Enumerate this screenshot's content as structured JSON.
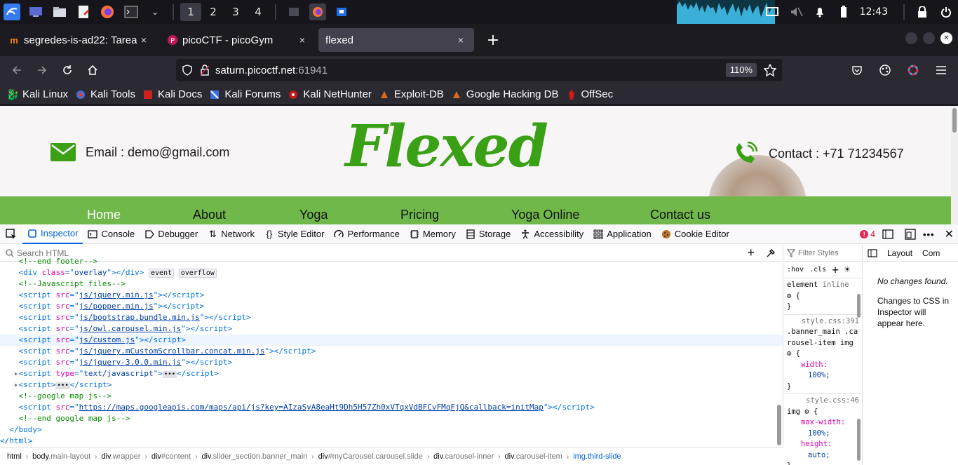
{
  "taskbar": {
    "workspaces": [
      "1",
      "2",
      "3",
      "4"
    ],
    "clock": "12:43"
  },
  "tabs": [
    {
      "title": "segredes-is-ad22: Tarea 5",
      "close": "×"
    },
    {
      "title": "picoCTF - picoGym",
      "close": "×"
    },
    {
      "title": "flexed",
      "close": "×"
    }
  ],
  "new_tab": "+",
  "urlbar": {
    "url_host": "saturn.picoctf.net",
    "url_port": ":61941",
    "zoom": "110%"
  },
  "bookmarks": [
    "Kali Linux",
    "Kali Tools",
    "Kali Docs",
    "Kali Forums",
    "Kali NetHunter",
    "Exploit-DB",
    "Google Hacking DB",
    "OffSec"
  ],
  "page": {
    "email": "Email : demo@gmail.com",
    "logo": "Flexed",
    "contact": "Contact : +71 71234567",
    "nav": [
      "Home",
      "About",
      "Yoga",
      "Pricing",
      "Yoga Online",
      "Contact us"
    ],
    "brand_color": "#3aa015",
    "nav_color": "#70b84a"
  },
  "devtools": {
    "tabs": [
      "Inspector",
      "Console",
      "Debugger",
      "Network",
      "Style Editor",
      "Performance",
      "Memory",
      "Storage",
      "Accessibility",
      "Application",
      "Cookie Editor"
    ],
    "error_count": "4",
    "search_placeholder": "Search HTML",
    "code_lines": {
      "l0": "<!--end footer-->",
      "l2": "<!--Javascript files-->",
      "l12": "<!--google map js-->",
      "l14": "<!--end google map js-->",
      "overlay_badges": [
        "event",
        "overflow"
      ],
      "scripts": [
        "js/jquery.min.js",
        "js/popper.min.js",
        "js/bootstrap.bundle.min.js",
        "js/owl.carousel.min.js",
        "js/custom.js",
        "js/jquery.mCustomScrollbar.concat.min.js",
        "js/jquery-3.0.0.min.js"
      ],
      "text_js_type": "text/javascript",
      "maps_src": "https://maps.googleapis.com/maps/api/js?key=AIzaSyA8eaHt9Dh5H57Zh0xVTqxVdBFCvFMqFjQ&callback=initMap"
    },
    "breadcrumbs": [
      {
        "tag": "html",
        "cls": ""
      },
      {
        "tag": "body",
        "cls": ".main-layout"
      },
      {
        "tag": "div",
        "cls": ".wrapper"
      },
      {
        "tag": "div",
        "cls": "#content"
      },
      {
        "tag": "div",
        "cls": ".slider_section.banner_main"
      },
      {
        "tag": "div",
        "cls": "#myCarousel.carousel.slide"
      },
      {
        "tag": "div",
        "cls": ".carousel-inner"
      },
      {
        "tag": "div",
        "cls": ".carousel-item"
      },
      {
        "tag": "img",
        "cls": ".third-slide"
      }
    ],
    "rules": {
      "filter_placeholder": "Filter Styles",
      "hov": ":hov",
      "cls": ".cls",
      "element": "element",
      "inline": "inline",
      "rule1_src": "style.css:391",
      "rule1_sel": ".banner_main .carousel-item img",
      "rule1_prop": "width:",
      "rule1_val": "100%;",
      "rule2_src": "style.css:46",
      "rule2_sel": "img",
      "rule2_prop1": "max-width:",
      "rule2_val1": "100%;",
      "rule2_prop2": "height:",
      "rule2_val2": "auto;"
    },
    "changes": {
      "tabs": [
        "Layout",
        "Com"
      ],
      "no_changes": "No changes found.",
      "hint": "Changes to CSS in Inspector will appear here."
    }
  }
}
